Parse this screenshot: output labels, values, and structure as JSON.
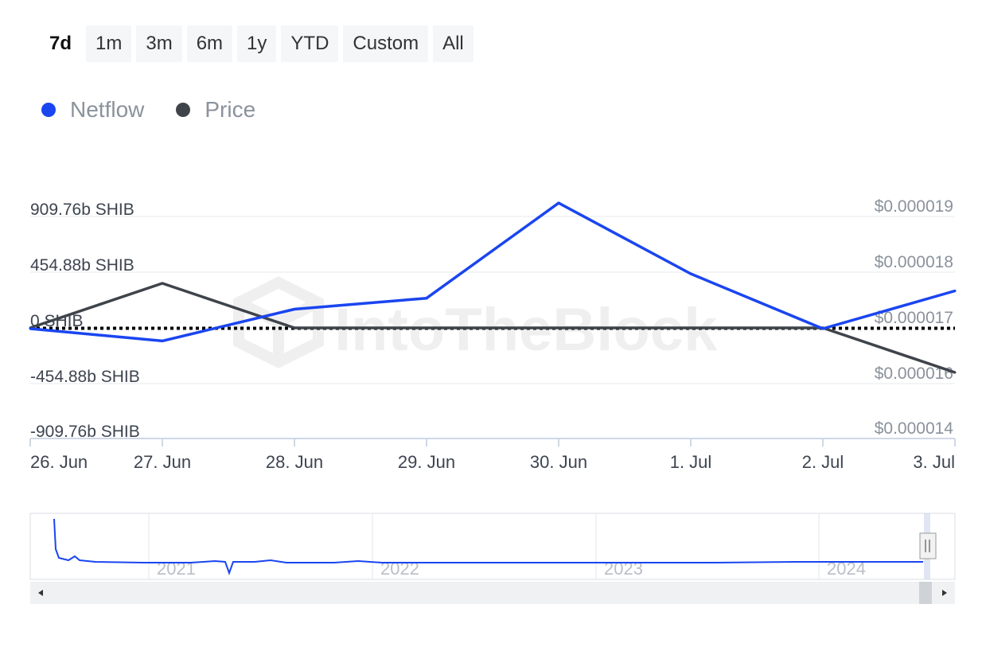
{
  "range_selector": {
    "buttons": [
      "7d",
      "1m",
      "3m",
      "6m",
      "1y",
      "YTD",
      "Custom",
      "All"
    ],
    "active": "7d"
  },
  "legend": [
    {
      "name": "Netflow",
      "color": "#1a45f0",
      "icon": "dot-icon"
    },
    {
      "name": "Price",
      "color": "#3f444b",
      "icon": "dot-icon"
    }
  ],
  "watermark": "IntoTheBlock",
  "chart_data": {
    "type": "line",
    "x": [
      "26. Jun",
      "27. Jun",
      "28. Jun",
      "29. Jun",
      "30. Jun",
      "1. Jul",
      "2. Jul",
      "3. Jul"
    ],
    "x_tick_labels": [
      "26. Jun",
      "27. Jun",
      "28. Jun",
      "29. Jun",
      "30. Jun",
      "1. Jul",
      "2. Jul",
      "3. Jul"
    ],
    "series": [
      {
        "name": "Netflow",
        "axis": "left",
        "unit": "b SHIB",
        "color": "#1a45f0",
        "values": [
          -10,
          -110,
          150,
          240,
          1020,
          440,
          -10,
          300
        ]
      },
      {
        "name": "Price",
        "axis": "right",
        "unit": "USD",
        "color": "#3f444b",
        "values": [
          1.7e-05,
          1.78e-05,
          1.7e-05,
          1.7e-05,
          1.7e-05,
          1.7e-05,
          1.7e-05,
          1.62e-05
        ]
      }
    ],
    "y_left_ticks": [
      "909.76b SHIB",
      "454.88b SHIB",
      "0 SHIB",
      "-454.88b SHIB",
      "-909.76b SHIB"
    ],
    "y_left_tick_values": [
      909.76,
      454.88,
      0,
      -454.88,
      -909.76
    ],
    "y_right_ticks": [
      "$0.000019",
      "$0.000018",
      "$0.000017",
      "$0.000016",
      "$0.000014"
    ],
    "y_right_tick_values": [
      1.9e-05,
      1.8e-05,
      1.7e-05,
      1.6e-05,
      1.4e-05
    ],
    "zero_line": "dotted",
    "grid": true,
    "navigator": {
      "labels": [
        "2021",
        "2022",
        "2023",
        "2024"
      ]
    }
  },
  "colors": {
    "netflow": "#1a45f0",
    "price": "#3f444b",
    "grid": "#e6e9ee",
    "zero_line": "#000000"
  }
}
